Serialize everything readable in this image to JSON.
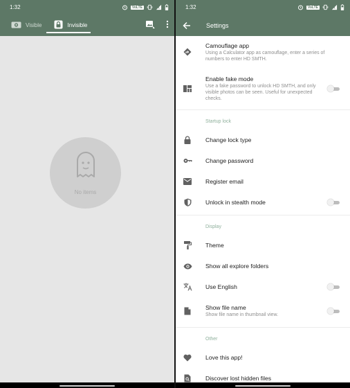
{
  "left": {
    "status": {
      "time": "1:32",
      "volte": "VoLTE"
    },
    "tabs": [
      {
        "label": "Visible",
        "icon": "eye-icon"
      },
      {
        "label": "Invisible",
        "icon": "lock-icon"
      }
    ],
    "empty_text": "No items"
  },
  "right": {
    "status": {
      "time": "1:32",
      "volte": "VoLTE"
    },
    "title": "Settings",
    "items": {
      "camouflage": {
        "title": "Camouflage app",
        "sub": "Using a Calculator app as camouflage, enter a series of numbers to enter HD SMTH."
      },
      "fake_mode": {
        "title": "Enable fake mode",
        "sub": "Use a fake password to unlock HD SMTH, and only visible photos can be seen. Useful for unexpected checks."
      },
      "change_lock_type": {
        "title": "Change lock type"
      },
      "change_password": {
        "title": "Change password"
      },
      "register_email": {
        "title": "Register email"
      },
      "stealth": {
        "title": "Unlock in stealth mode"
      },
      "theme": {
        "title": "Theme"
      },
      "explore_folders": {
        "title": "Show all explore folders"
      },
      "english": {
        "title": "Use English"
      },
      "file_name": {
        "title": "Show file name",
        "sub": "Show file name in thumbnail view."
      },
      "love": {
        "title": "Love this app!"
      },
      "discover": {
        "title": "Discover lost hidden files"
      }
    },
    "sections": {
      "startup": "Startup lock",
      "display": "Display",
      "other": "Other"
    }
  },
  "colors": {
    "toolbar": "#5d7866",
    "section": "#8fb09c"
  }
}
